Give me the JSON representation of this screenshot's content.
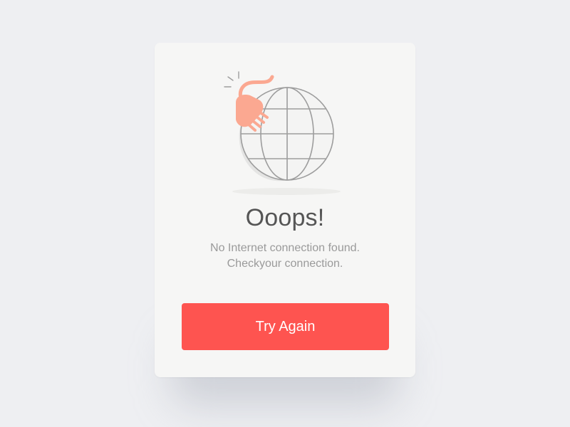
{
  "dialog": {
    "title": "Ooops!",
    "message_line1": "No Internet connection found.",
    "message_line2": "Checkyour connection.",
    "button_label": "Try Again"
  },
  "icons": {
    "illustration": "globe-with-unplugged-cable-icon"
  },
  "colors": {
    "background": "#eeeff2",
    "card": "#f6f6f5",
    "accent": "#fe5450",
    "plug": "#fba891",
    "globe_line": "#9d9d9d",
    "title": "#555555",
    "message": "#9a9a9a"
  }
}
